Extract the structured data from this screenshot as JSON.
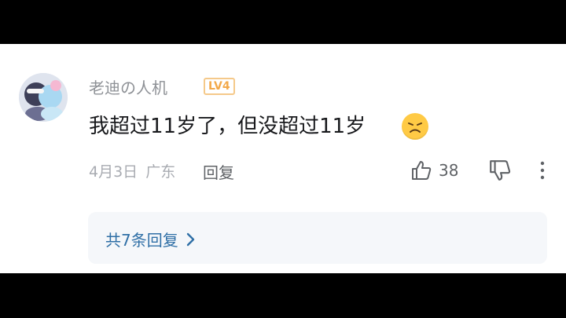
{
  "comment": {
    "username": "老迪の人机",
    "level": "LV4",
    "text": "我超过11岁了，但没超过11岁",
    "emoji_icon": "disappointed-face-emoji",
    "date": "4月3日",
    "location": "广东",
    "reply_label": "回复",
    "like_count": "38"
  },
  "replies": {
    "label": "共7条回复"
  },
  "colors": {
    "badge": "#f3a94a",
    "link": "#2f6fa6",
    "emoji": "#ffca45"
  }
}
